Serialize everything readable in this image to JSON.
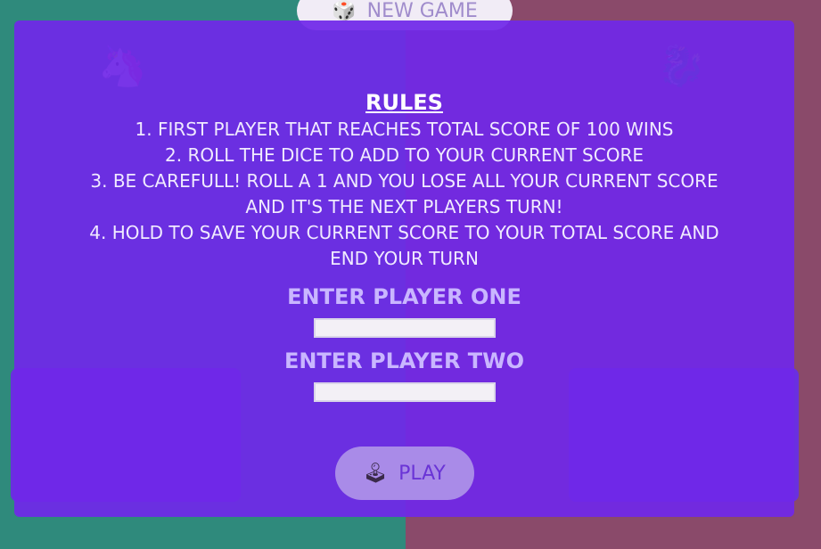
{
  "app": {
    "new_game_label": "NEW GAME",
    "new_game_icon": "dice-icon"
  },
  "background": {
    "left_color": "#2f8a7c",
    "right_color": "#8a4a6a",
    "player_one_icon": "unicorn-icon",
    "player_two_icon": "dragon-icon"
  },
  "rules": {
    "title": "RULES",
    "items": [
      "1. FIRST PLAYER THAT REACHES TOTAL SCORE OF 100 WINS",
      "2. ROLL THE DICE TO ADD TO YOUR CURRENT SCORE",
      "3. BE CAREFULL! ROLL A 1 AND YOU LOSE ALL YOUR CURRENT SCORE AND IT'S THE NEXT PLAYERS TURN!",
      "4. HOLD TO SAVE YOUR CURRENT SCORE TO YOUR TOTAL SCORE AND END YOUR TURN"
    ]
  },
  "form": {
    "player_one_label": "ENTER PLAYER ONE",
    "player_one_value": "",
    "player_two_label": "ENTER PLAYER TWO",
    "player_two_value": ""
  },
  "play": {
    "label": "PLAY",
    "icon": "joystick-icon"
  },
  "colors": {
    "overlay": "#7028e8",
    "play_button": "#a98be8"
  }
}
